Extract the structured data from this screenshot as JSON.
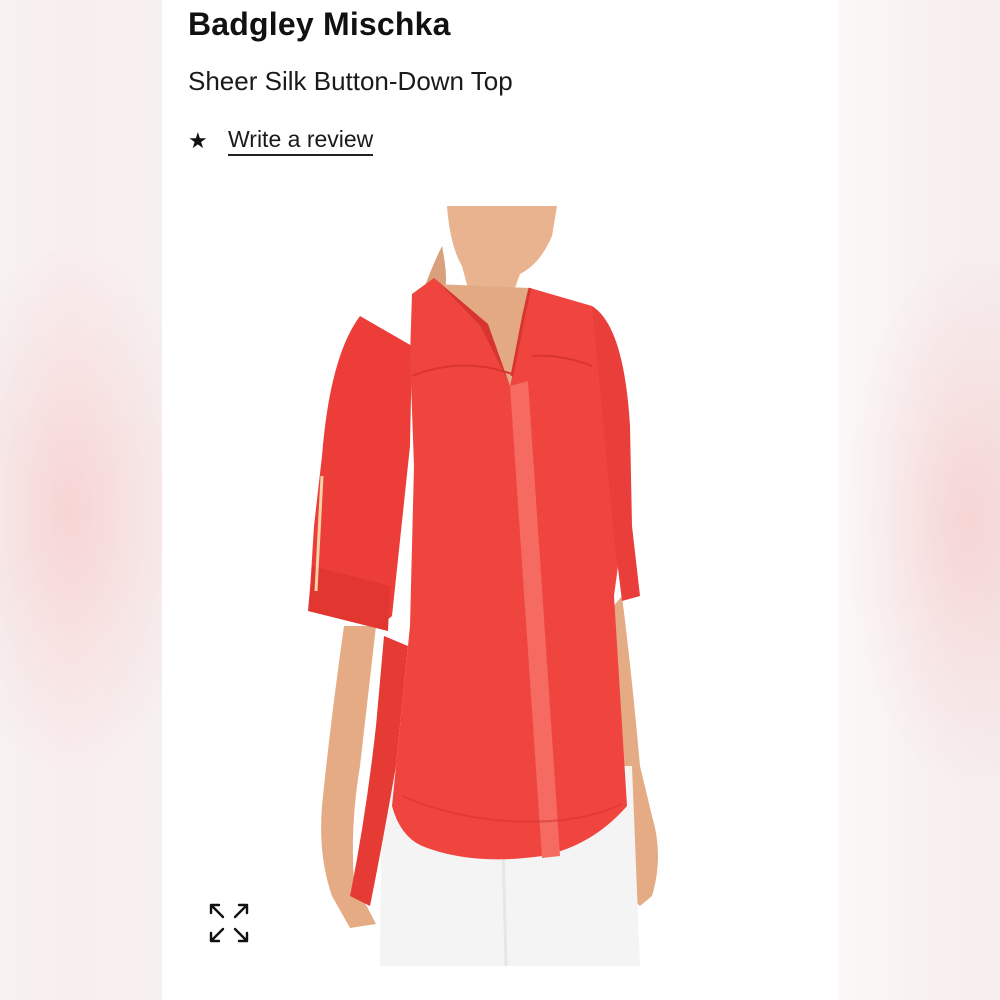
{
  "product": {
    "brand": "Badgley Mischka",
    "name": "Sheer Silk Button-Down Top",
    "review_link": "Write a review",
    "star_icon": "star-icon"
  },
  "image": {
    "garment_color": "#f0453f",
    "alt": "expand-icon"
  },
  "colors": {
    "text": "#111111",
    "background": "#ffffff",
    "garment": "#f0453f"
  }
}
